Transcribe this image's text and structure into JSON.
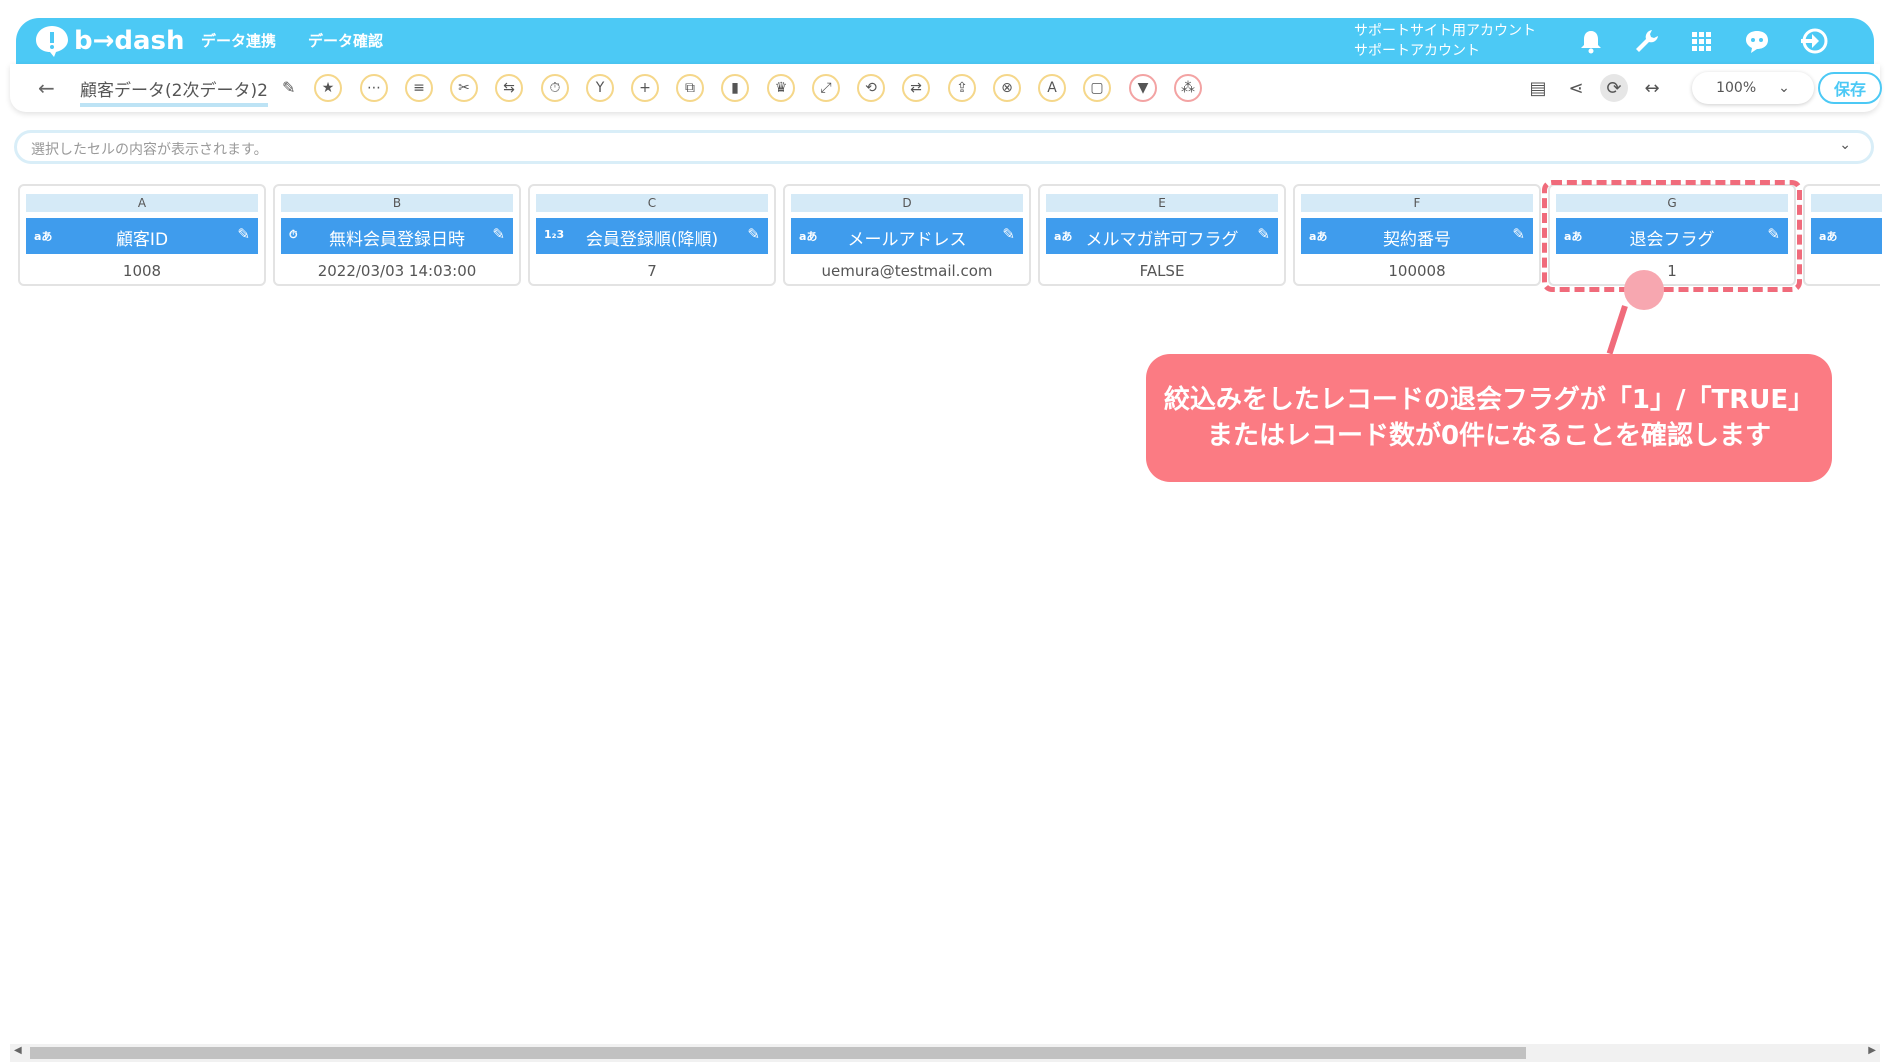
{
  "header": {
    "logo_text": "b→dash",
    "nav": [
      "データ連携",
      "データ確認"
    ],
    "account_line1": "サポートサイト用アカウント",
    "account_line2": "サポートアカウント",
    "icons": [
      "bell-icon",
      "wrench-icon",
      "grid-icon",
      "chat-icon",
      "logout-icon"
    ]
  },
  "toolbar": {
    "back": "←",
    "title": "顧客データ(2次データ)2",
    "zoom_value": "100%",
    "save_label": "保存",
    "tools": [
      "star-icon",
      "dots-icon",
      "list-icon",
      "scissors-icon",
      "merge-icon",
      "timer-icon",
      "branch-icon",
      "plus-icon",
      "copy-icon",
      "trash-icon",
      "crown-icon",
      "expand-icon",
      "repeat-icon",
      "transform-icon",
      "upload-icon",
      "close-circle-icon",
      "replace-icon",
      "square-icon",
      "filter-icon",
      "grid-pattern-icon"
    ]
  },
  "cellbar": {
    "placeholder": "選択したセルの内容が表示されます。"
  },
  "columns": [
    {
      "letter": "A",
      "type": "aあ",
      "name": "顧客ID",
      "value": "1008"
    },
    {
      "letter": "B",
      "type": "⏱",
      "name": "無料会員登録日時",
      "value": "2022/03/03 14:03:00"
    },
    {
      "letter": "C",
      "type": "1₂3",
      "name": "会員登録順(降順)",
      "value": "7"
    },
    {
      "letter": "D",
      "type": "aあ",
      "name": "メールアドレス",
      "value": "uemura@testmail.com"
    },
    {
      "letter": "E",
      "type": "aあ",
      "name": "メルマガ許可フラグ",
      "value": "FALSE"
    },
    {
      "letter": "F",
      "type": "aあ",
      "name": "契約番号",
      "value": "100008"
    },
    {
      "letter": "G",
      "type": "aあ",
      "name": "退会フラグ",
      "value": "1"
    },
    {
      "letter": "",
      "type": "aあ",
      "name": "",
      "value": ""
    }
  ],
  "callout": {
    "line1": "絞込みをしたレコードの退会フラグが「1」/「TRUE」",
    "line2": "またはレコード数が0件になることを確認します"
  }
}
